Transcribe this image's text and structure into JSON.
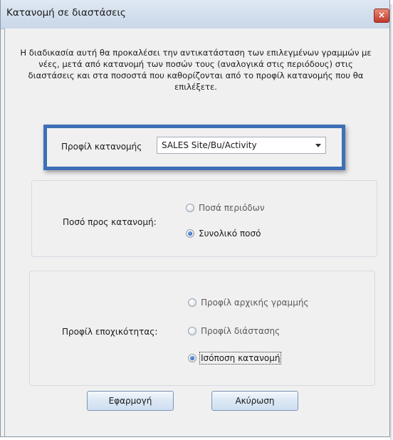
{
  "window": {
    "title": "Κατανομή σε διαστάσεις",
    "close_glyph": "×"
  },
  "description": "Η διαδικασία αυτή θα προκαλέσει την αντικατάσταση των επιλεγμένων γραμμών με νέες, μετά από κατανομή των ποσών τους (αναλογικά στις περιόδους) στις διαστάσεις και στα ποσοστά που καθορίζονται από το προφίλ κατανομής που θα επιλέξετε.",
  "allocation_profile": {
    "label": "Προφίλ κατανομής",
    "selected": "SALES Site/Bu/Activity"
  },
  "amount_group": {
    "label": "Ποσό προς κατανομή:",
    "options": [
      {
        "label": "Ποσά περιόδων",
        "checked": false,
        "enabled": false
      },
      {
        "label": "Συνολικό ποσό",
        "checked": true,
        "enabled": true
      }
    ]
  },
  "seasonality_group": {
    "label": "Προφίλ εποχικότητας:",
    "options": [
      {
        "label": "Προφίλ αρχικής γραμμής",
        "checked": false,
        "enabled": false
      },
      {
        "label": "Προφίλ διάστασης",
        "checked": false,
        "enabled": false
      },
      {
        "label": "Ισόποση κατανομή",
        "checked": true,
        "enabled": true
      }
    ]
  },
  "buttons": {
    "apply": "Εφαρμογή",
    "cancel": "Ακύρωση"
  },
  "colors": {
    "highlight_border": "#3d6fb6",
    "dialog_background": "#f0f0f0",
    "close_button": "#c0392b"
  }
}
